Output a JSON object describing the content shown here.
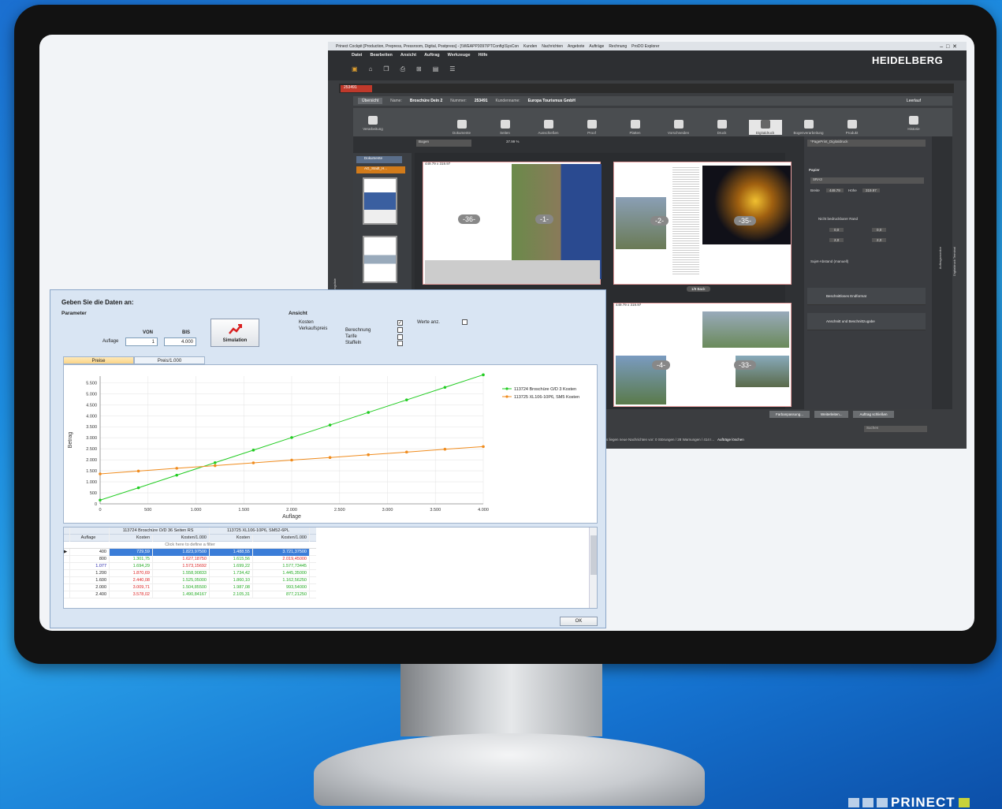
{
  "cockpit": {
    "title": "Prinect Cockpit [Production, Prepress, Pressroom, Digital, Postpress] - [\\\\WEAPP3097\\PTConfig\\SysCon",
    "title_items": [
      "Kunden",
      "Nachrichten",
      "Angebote",
      "Aufträge",
      "Rechnung",
      "ProDO Explorer"
    ],
    "menu": [
      "Datei",
      "Bearbeiten",
      "Ansicht",
      "Auftrag",
      "Werkzeuge",
      "Hilfe"
    ],
    "logo": "HEIDELBERG",
    "job_tab": "253491",
    "overview_label": "Übersicht",
    "name_label": "Name:",
    "name_value": "Broschüre Dein 2",
    "number_label": "Nummer:",
    "number_value": "253491",
    "customer_label": "Kundenname:",
    "customer_value": "Europa Tourismus GmbH",
    "leerlauf": "Leerlauf",
    "steps": [
      "Verarbeitung",
      "Dokumente",
      "Seiten",
      "Ausschießen",
      "Proof",
      "Platten",
      "Vorschneiden",
      "Druck",
      "Digitaldruck",
      "Bogenverarbeitung",
      "Produkt",
      "Historie"
    ],
    "view_mode": "Bogen",
    "zoom": "37.99 %",
    "documents_label": "Dokumente",
    "ag_label": "AG_Stadt_H...",
    "spread_caption_1": "449.79 x 319.97",
    "spread_caption_2": "449.79 x 319.97",
    "spread_caption_3": "449.79 x 319.97",
    "pages": [
      "-36-",
      "-1-",
      "-2-",
      "-35-",
      "-4-",
      "-33-"
    ],
    "back_label": "1/9 Back",
    "right_input": "*PagePrint_Digitaldruck",
    "papier_label": "Papier",
    "papier_value": "SRA3",
    "breite_label": "Breite",
    "breite_value": "449.79",
    "hoehe_label": "Höhe",
    "hoehe_value": "319.97",
    "nicht_bedruckbar": "Nicht bedruckbarer Rand",
    "margin_values": [
      "0,0",
      "0,0",
      "2,0",
      "2,0"
    ],
    "sujet_label": "Sujet-Abstand (manuell)",
    "beschnitt_endformat": "Beschnittloses Endformat",
    "anschnitt": "Anschnitt und Beschnittzugabe",
    "side_labels": [
      "Auftragsliste",
      "Auftragsmonitor",
      "Digitaldruck Terminal"
    ],
    "buttons": [
      "Farbanpassung...",
      "Weiterleiten...",
      "Auftrag schließen"
    ],
    "search_placeholder": "Suchen",
    "status": "Es liegen neue Nachrichten vor: 0 Störungen / 28 Warnungen / 414 I...",
    "status_btn": "Aufträge löschen"
  },
  "dialog": {
    "title": "Geben Sie die Daten an:",
    "parameter": "Parameter",
    "ansicht": "Ansicht",
    "von": "VON",
    "bis": "BIS",
    "auflage_label": "Auflage",
    "von_value": "1",
    "bis_value": "4.000",
    "simulation": "Simulation",
    "kosten": "Kosten",
    "verkaufspreis": "Verkaufspreis",
    "berechnung": "Berechnung",
    "tarife": "Tarife",
    "staffeln": "Staffeln",
    "werte_anz": "Werte anz.",
    "tab_preise": "Preise",
    "tab_preis1000": "Preis/1.000",
    "ok": "OK",
    "grid": {
      "group1": "113724 Broschüre O/D 36 Seiten RS",
      "group2": "113725 XL106-10P6, SM52-6PL",
      "col_auflage": "Auflage",
      "col_kosten": "Kosten",
      "col_kosten1000": "Kosten/1.000",
      "filter_hint": "Click here to define a filter",
      "rows": [
        [
          "400",
          "729,59",
          "1.823,97500",
          "1.488,55",
          "3.721,37500"
        ],
        [
          "800",
          "1.301,75",
          "1.627,18750",
          "1.615,56",
          "2.019,45000"
        ],
        [
          "1.077",
          "1.694,29",
          "1.573,15692",
          "1.699,22",
          "1.577,73445"
        ],
        [
          "1.200",
          "1.870,69",
          "1.558,90833",
          "1.734,42",
          "1.445,35000"
        ],
        [
          "1.600",
          "2.440,08",
          "1.525,05000",
          "1.860,10",
          "1.162,56250"
        ],
        [
          "2.000",
          "3.009,71",
          "1.504,85500",
          "1.987,08",
          "993,54000"
        ],
        [
          "2.400",
          "3.578,02",
          "1.490,84167",
          "2.105,31",
          "877,21250"
        ]
      ]
    }
  },
  "chart_data": {
    "type": "line",
    "title": "",
    "xlabel": "Auflage",
    "ylabel": "Betrag",
    "xlim": [
      0,
      4000
    ],
    "ylim": [
      0,
      5800
    ],
    "xticks": [
      "0",
      "500",
      "1.000",
      "1.500",
      "2.000",
      "2.500",
      "3.000",
      "3.500",
      "4.000"
    ],
    "yticks": [
      "0",
      "500",
      "1.000",
      "1.500",
      "2.000",
      "2.500",
      "3.000",
      "3.500",
      "4.000",
      "4.500",
      "5.000",
      "5.500"
    ],
    "grid": true,
    "legend_position": "right",
    "series": [
      {
        "name": "113724 Broschüre O/D 3 Kosten",
        "color": "#22cc22",
        "x": [
          0,
          400,
          800,
          1200,
          1600,
          2000,
          2400,
          2800,
          3200,
          3600,
          4000
        ],
        "y": [
          170,
          729.59,
          1301.75,
          1870.69,
          2440.08,
          3009.71,
          3578.02,
          4150,
          4720,
          5290,
          5860
        ]
      },
      {
        "name": "113725 XL106-10P6, SM5 Kosten",
        "color": "#f08c1e",
        "x": [
          0,
          400,
          800,
          1200,
          1600,
          2000,
          2400,
          2800,
          3200,
          3600,
          4000
        ],
        "y": [
          1360,
          1488.55,
          1615.56,
          1734.42,
          1860.1,
          1987.08,
          2105.31,
          2230,
          2350,
          2480,
          2600
        ]
      }
    ]
  },
  "brand": {
    "prinect": "PRINECT"
  },
  "colors": {
    "accent_orange": "#d27b1a",
    "chart_green": "#22cc22",
    "chart_orange": "#f08c1e",
    "selection_blue": "#3b7dd8"
  }
}
